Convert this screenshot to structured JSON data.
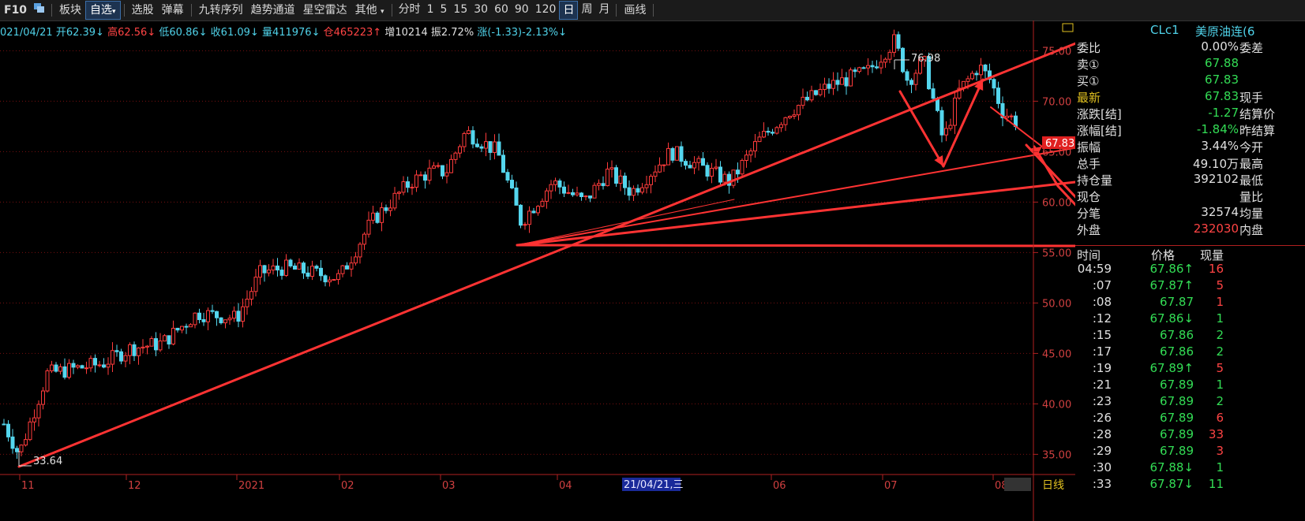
{
  "toolbar": {
    "f10": "F10",
    "items": [
      "板块",
      "自选",
      "选股",
      "弹幕",
      "九转序列",
      "趋势通道",
      "星空雷达",
      "其他"
    ],
    "selected_index": 1,
    "periods": [
      "分时",
      "1",
      "5",
      "15",
      "30",
      "60",
      "90",
      "120",
      "日",
      "周",
      "月"
    ],
    "selected_period": 8,
    "draw": "画线"
  },
  "quote_bar": {
    "date": "021/04/21",
    "open_label": "开",
    "open": "62.39",
    "high_label": "高",
    "high": "62.56",
    "low_label": "低",
    "low": "60.86",
    "close_label": "收",
    "close": "61.09",
    "vol_label": "量",
    "vol": "411976",
    "oi_label": "仓",
    "oi": "465223",
    "add_label": "增",
    "add": "10214",
    "amp_label": "振",
    "amp": "2.72%",
    "chg_label": "涨",
    "chg": "(-1.33)-2.13%"
  },
  "chart": {
    "y_ticks": [
      "75.00",
      "70.00",
      "65.00",
      "60.00",
      "55.00",
      "50.00",
      "45.00",
      "40.00",
      "35.00"
    ],
    "x_ticks": [
      "11",
      "12",
      "2021",
      "02",
      "03",
      "04",
      "06",
      "07",
      "08"
    ],
    "cursor_date": "21/04/21,三",
    "high_label": "76.98",
    "low_label": "33.64",
    "last_price_tag": "67.83",
    "period_label": "日线"
  },
  "chart_data": {
    "type": "candlestick",
    "y_range": [
      33,
      78
    ],
    "annotated_high": 76.98,
    "annotated_low": 33.64,
    "last": 67.83
  },
  "panel": {
    "symbol": "CLc1",
    "name": "美原油连(6",
    "rows": [
      {
        "lbl": "委比",
        "val": "0.00%",
        "lbl2": "委差",
        "vc": "wh"
      },
      {
        "lbl": "卖①",
        "val": "67.88",
        "lbl2": "",
        "vc": "dn"
      },
      {
        "lbl": "买①",
        "val": "67.83",
        "lbl2": "",
        "vc": "dn"
      },
      {
        "lbl": "最新",
        "val": "67.83",
        "lbl2": "现手",
        "vc": "dn"
      },
      {
        "lbl": "涨跌[结]",
        "val": "-1.27",
        "lbl2": "结算价",
        "vc": "dn"
      },
      {
        "lbl": "涨幅[结]",
        "val": "-1.84%",
        "lbl2": "昨结算",
        "vc": "dn"
      },
      {
        "lbl": "振幅",
        "val": "3.44%",
        "lbl2": "今开",
        "vc": "wh"
      },
      {
        "lbl": "总手",
        "val": "49.10万",
        "lbl2": "最高",
        "vc": "wh"
      },
      {
        "lbl": "持仓量",
        "val": "392102",
        "lbl2": "最低",
        "vc": "wh"
      },
      {
        "lbl": "现仓",
        "val": "",
        "lbl2": "量比",
        "vc": "wh"
      },
      {
        "lbl": "分笔",
        "val": "32574",
        "lbl2": "均量",
        "vc": "wh"
      },
      {
        "lbl": "外盘",
        "val": "232030",
        "lbl2": "内盘",
        "vc": "up"
      }
    ],
    "ticks_head": {
      "time": "时间",
      "price": "价格",
      "vol": "现量"
    },
    "ticks": [
      {
        "t": "04:59",
        "p": "67.86↑",
        "v": "16",
        "pc": "dn",
        "vc": "up"
      },
      {
        "t": ":07",
        "p": "67.87↑",
        "v": "5",
        "pc": "dn",
        "vc": "up"
      },
      {
        "t": ":08",
        "p": "67.87",
        "v": "1",
        "pc": "dn",
        "vc": "up"
      },
      {
        "t": ":12",
        "p": "67.86↓",
        "v": "1",
        "pc": "dn",
        "vc": "dn"
      },
      {
        "t": ":15",
        "p": "67.86",
        "v": "2",
        "pc": "dn",
        "vc": "dn"
      },
      {
        "t": ":17",
        "p": "67.86",
        "v": "2",
        "pc": "dn",
        "vc": "dn"
      },
      {
        "t": ":19",
        "p": "67.89↑",
        "v": "5",
        "pc": "dn",
        "vc": "up"
      },
      {
        "t": ":21",
        "p": "67.89",
        "v": "1",
        "pc": "dn",
        "vc": "dn"
      },
      {
        "t": ":23",
        "p": "67.89",
        "v": "2",
        "pc": "dn",
        "vc": "dn"
      },
      {
        "t": ":26",
        "p": "67.89",
        "v": "6",
        "pc": "dn",
        "vc": "up"
      },
      {
        "t": ":28",
        "p": "67.89",
        "v": "33",
        "pc": "dn",
        "vc": "up"
      },
      {
        "t": ":29",
        "p": "67.89",
        "v": "3",
        "pc": "dn",
        "vc": "up"
      },
      {
        "t": ":30",
        "p": "67.88↓",
        "v": "1",
        "pc": "dn",
        "vc": "dn"
      },
      {
        "t": ":33",
        "p": "67.87↓",
        "v": "11",
        "pc": "dn",
        "vc": "dn"
      }
    ]
  }
}
